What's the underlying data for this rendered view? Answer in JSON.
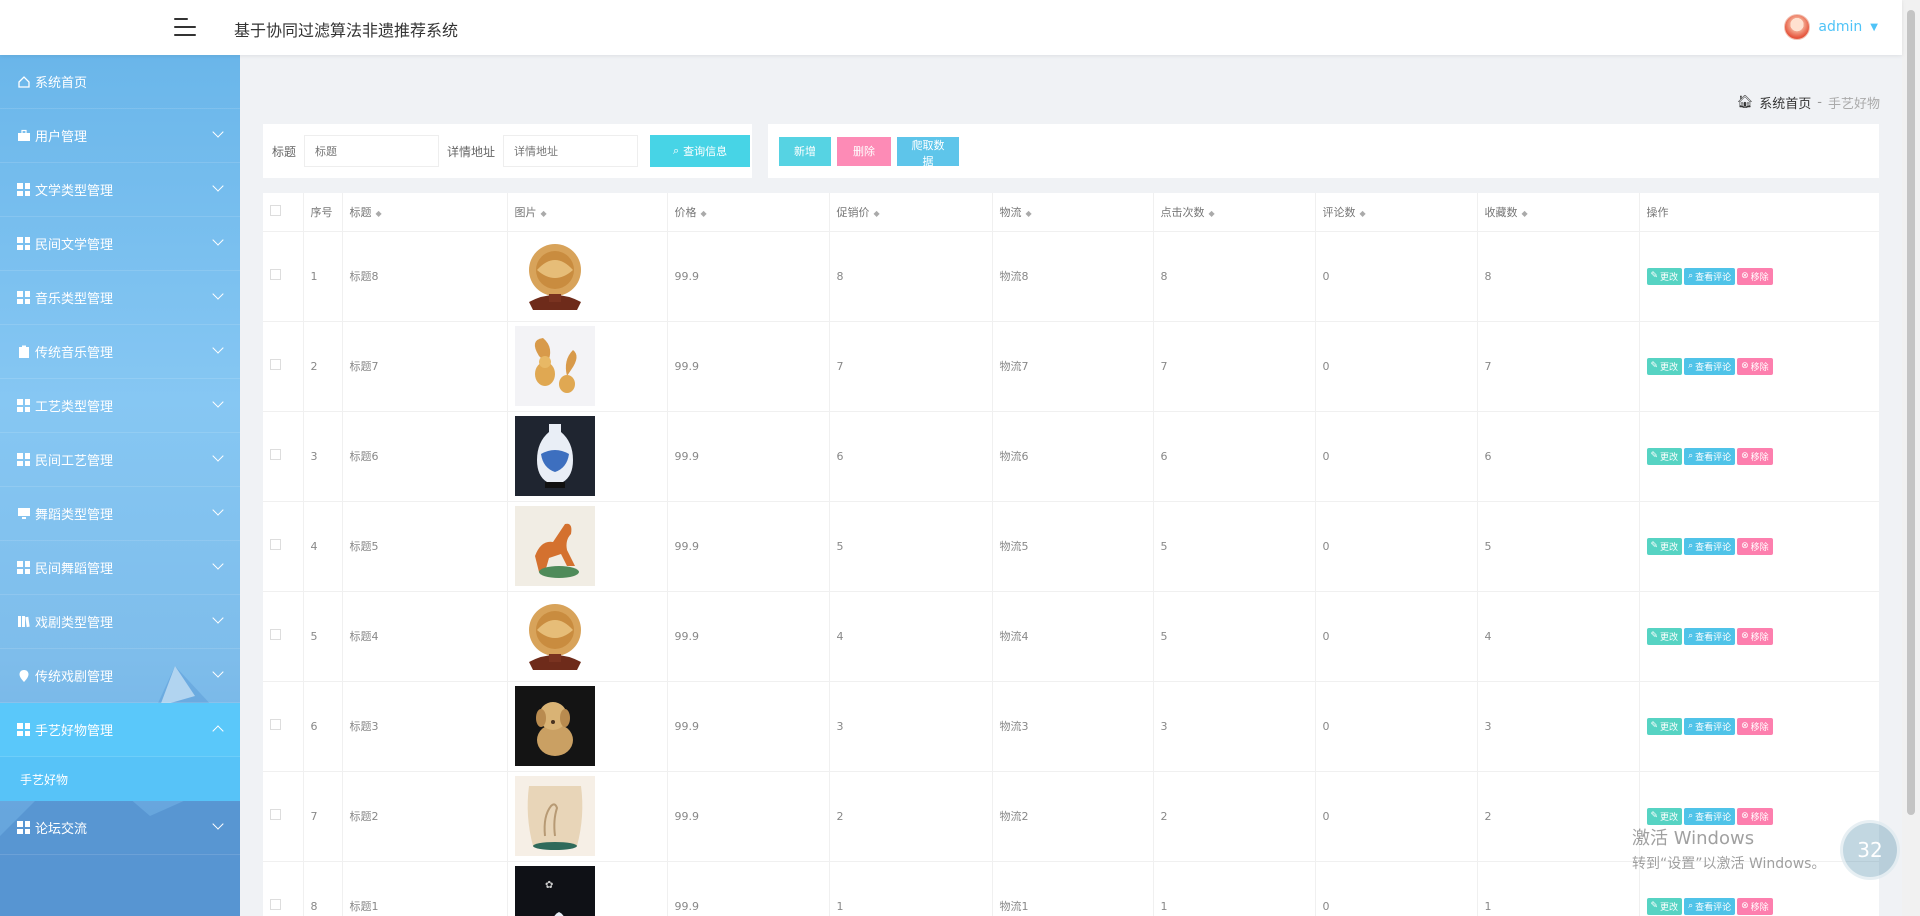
{
  "header": {
    "title": "基于协同过滤算法非遗推荐系统",
    "username": "admin"
  },
  "sidebar": {
    "items": [
      {
        "label": "系统首页",
        "icon": "home-icon",
        "expandable": false
      },
      {
        "label": "用户管理",
        "icon": "briefcase-icon",
        "expandable": true
      },
      {
        "label": "文学类型管理",
        "icon": "grid-icon",
        "expandable": true
      },
      {
        "label": "民间文学管理",
        "icon": "grid-icon",
        "expandable": true
      },
      {
        "label": "音乐类型管理",
        "icon": "grid-icon",
        "expandable": true
      },
      {
        "label": "传统音乐管理",
        "icon": "clipboard-icon",
        "expandable": true
      },
      {
        "label": "工艺类型管理",
        "icon": "grid-icon",
        "expandable": true
      },
      {
        "label": "民间工艺管理",
        "icon": "grid-icon",
        "expandable": true
      },
      {
        "label": "舞蹈类型管理",
        "icon": "monitor-icon",
        "expandable": true
      },
      {
        "label": "民间舞蹈管理",
        "icon": "grid-icon",
        "expandable": true
      },
      {
        "label": "戏剧类型管理",
        "icon": "book-icon",
        "expandable": true
      },
      {
        "label": "传统戏剧管理",
        "icon": "location-icon",
        "expandable": true
      },
      {
        "label": "手艺好物管理",
        "icon": "grid-icon",
        "expandable": true,
        "active": true
      },
      {
        "label": "论坛交流",
        "icon": "grid-icon",
        "expandable": true
      }
    ],
    "sub_item": "手艺好物"
  },
  "breadcrumb": {
    "home": "系统首页",
    "separator": "-",
    "current": "手艺好物"
  },
  "search": {
    "title_label": "标题",
    "title_placeholder": "标题",
    "address_label": "详情地址",
    "address_placeholder": "详情地址",
    "button": "查询信息"
  },
  "actions": {
    "add": "新增",
    "delete": "删除",
    "crawl": "爬取数据"
  },
  "table": {
    "headers": [
      "序号",
      "标题",
      "图片",
      "价格",
      "促销价",
      "物流",
      "点击次数",
      "评论数",
      "收藏数",
      "操作"
    ],
    "ops": {
      "edit": "更改",
      "view": "查看评论",
      "remove": "移除"
    },
    "rows": [
      {
        "id": "1",
        "title": "标题8",
        "image": "carved-plate",
        "price": "99.9",
        "promo": "8",
        "logistics": "物流8",
        "clicks": "8",
        "comments": "0",
        "favorites": "8"
      },
      {
        "id": "2",
        "title": "标题7",
        "image": "squirrel-figurines",
        "price": "99.9",
        "promo": "7",
        "logistics": "物流7",
        "clicks": "7",
        "comments": "0",
        "favorites": "7"
      },
      {
        "id": "3",
        "title": "标题6",
        "image": "blue-white-vase",
        "price": "99.9",
        "promo": "6",
        "logistics": "物流6",
        "clicks": "6",
        "comments": "0",
        "favorites": "6"
      },
      {
        "id": "4",
        "title": "标题5",
        "image": "horse-sculpture",
        "price": "99.9",
        "promo": "5",
        "logistics": "物流5",
        "clicks": "5",
        "comments": "0",
        "favorites": "5"
      },
      {
        "id": "5",
        "title": "标题4",
        "image": "carved-plate",
        "price": "99.9",
        "promo": "4",
        "logistics": "物流4",
        "clicks": "5",
        "comments": "0",
        "favorites": "4"
      },
      {
        "id": "6",
        "title": "标题3",
        "image": "dog-carving",
        "price": "99.9",
        "promo": "3",
        "logistics": "物流3",
        "clicks": "3",
        "comments": "0",
        "favorites": "3"
      },
      {
        "id": "7",
        "title": "标题2",
        "image": "crane-decor",
        "price": "99.9",
        "promo": "2",
        "logistics": "物流2",
        "clicks": "2",
        "comments": "0",
        "favorites": "2"
      },
      {
        "id": "8",
        "title": "标题1",
        "image": "vase-set",
        "price": "99.9",
        "promo": "1",
        "logistics": "物流1",
        "clicks": "1",
        "comments": "0",
        "favorites": "1"
      }
    ]
  },
  "overlay": {
    "watermark_line1": "激活 Windows",
    "watermark_line2": "转到“设置”以激活 Windows。",
    "badge": "32"
  },
  "colors": {
    "accent": "#4fc3f7",
    "edit": "#56d3c3",
    "view": "#4fc3e8",
    "remove": "#fd7fae",
    "add": "#56d3e3",
    "delete": "#fd8bb6"
  }
}
